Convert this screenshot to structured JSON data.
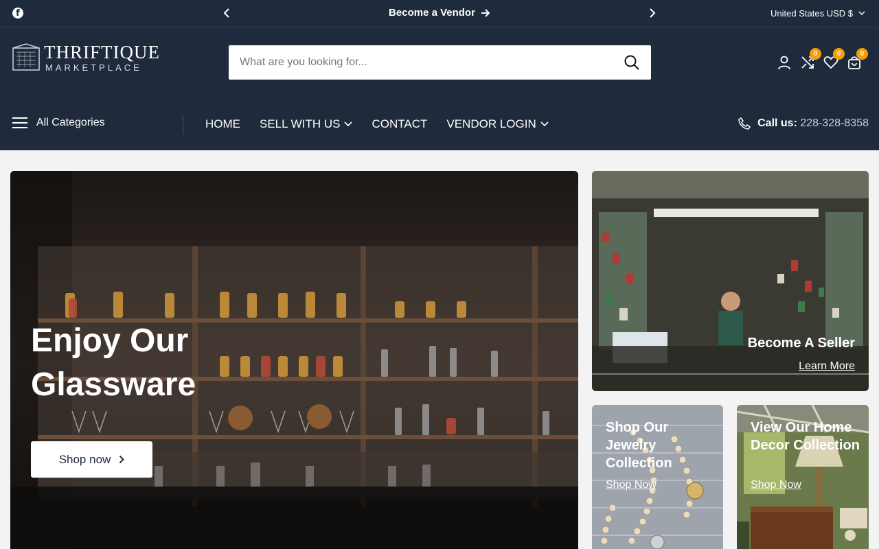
{
  "topbar": {
    "announcement": "Become a Vendor",
    "currency": "United States USD $",
    "icons": [
      "facebook-icon",
      "chevron-left-icon",
      "chevron-right-icon",
      "arrow-right-icon",
      "chevron-down-icon"
    ]
  },
  "header": {
    "logo_title": "THRIFTIQUE",
    "logo_subtitle": "MARKETPLACE",
    "search_placeholder": "What are you looking for...",
    "compare_count": "0",
    "wishlist_count": "0",
    "cart_count": "0",
    "icons": [
      "search-icon",
      "account-icon",
      "compare-icon",
      "heart-icon",
      "cart-icon"
    ]
  },
  "nav": {
    "all_categories": "All Categories",
    "items": [
      "HOME",
      "SELL WITH US",
      "CONTACT",
      "VENDOR LOGIN"
    ],
    "call_label": "Call us:",
    "phone": "228-328-8358"
  },
  "hero": {
    "title": "Enjoy Our Glassware",
    "button": "Shop now"
  },
  "tiles": {
    "seller": {
      "title": "Become A Seller",
      "link": "Learn More"
    },
    "jewelry": {
      "title": "Shop Our Jewelry Collection",
      "link": "Shop Now"
    },
    "decor": {
      "title": "View Our Home Decor Collection",
      "link": "Shop Now"
    }
  },
  "colors": {
    "navy": "#1f2a3c",
    "badge": "#f59e0b"
  }
}
